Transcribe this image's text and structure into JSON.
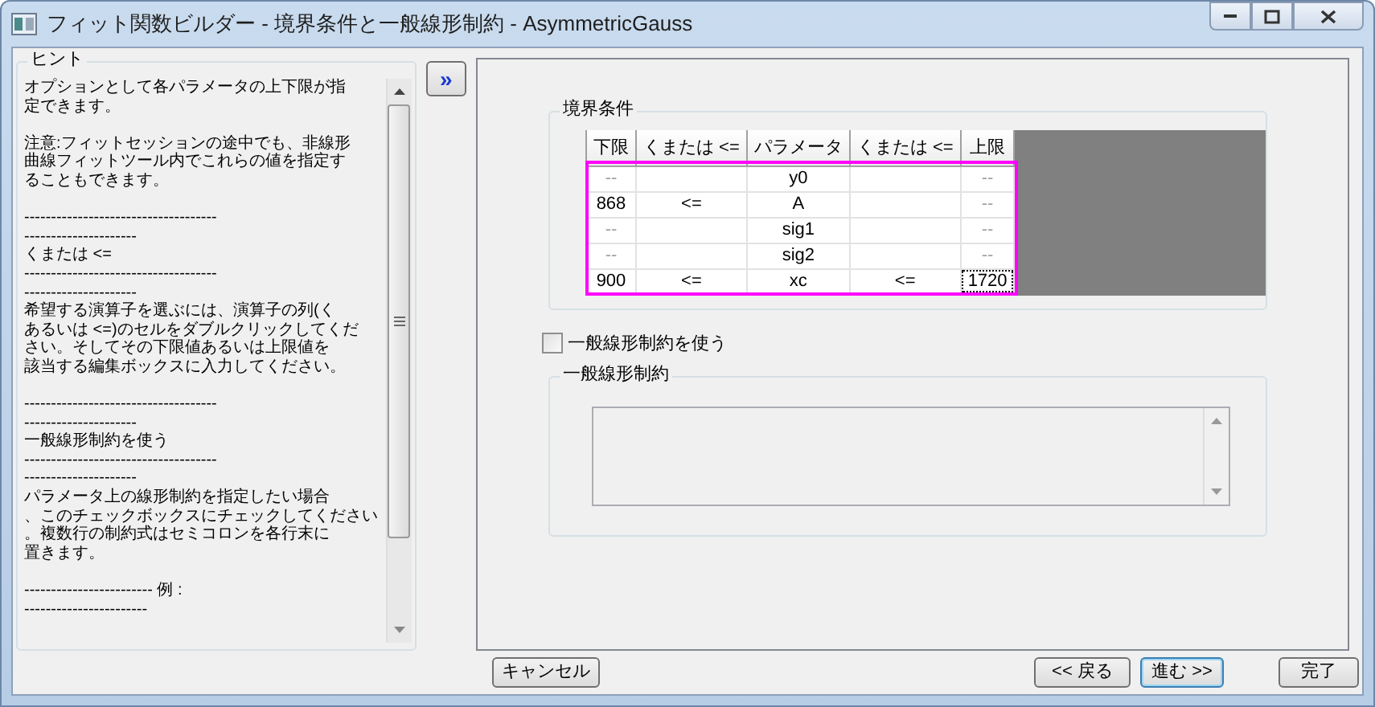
{
  "window": {
    "title": "フィット関数ビルダー - 境界条件と一般線形制約 - AsymmetricGauss"
  },
  "hint": {
    "title": "ヒント",
    "paragraphs": [
      {
        "lines": [
          "オプションとして各パラメータの上下限が指",
          "定できます。"
        ]
      },
      {
        "lines": [
          "注意:フィットセッションの途中でも、非線形",
          "曲線フィットツール内でこれらの値を指定す",
          "ることもできます。"
        ]
      },
      {
        "lines": [
          "------------------------------------",
          "---------------------",
          "くまたは <=",
          "------------------------------------",
          "---------------------",
          "希望する演算子を選ぶには、演算子の列(く",
          "あるいは <=)のセルをダブルクリックしてくだ",
          "さい。そしてその下限値あるいは上限値を",
          "該当する編集ボックスに入力してください。"
        ]
      },
      {
        "lines": [
          "------------------------------------",
          "---------------------",
          "一般線形制約を使う",
          "------------------------------------",
          "---------------------",
          "パラメータ上の線形制約を指定したい場合",
          "、このチェックボックスにチェックしてください",
          "。複数行の制約式はセミコロンを各行末に",
          "置きます。"
        ]
      },
      {
        "lines": [
          "------------------------ 例 :",
          "-----------------------"
        ]
      }
    ]
  },
  "expand_button": "»",
  "bounds": {
    "title": "境界条件",
    "columns": [
      "下限",
      "くまたは <=",
      "パラメータ",
      "くまたは <=",
      "上限"
    ],
    "rows": [
      {
        "lower": {
          "text": "--",
          "dim": true
        },
        "parameter": "y0",
        "upper": {
          "text": "--",
          "dim": true,
          "focused": false
        }
      },
      {
        "lower": {
          "text": "868",
          "dim": false
        },
        "lower_op": "<=",
        "parameter": "A",
        "upper": {
          "text": "--",
          "dim": true,
          "focused": false
        }
      },
      {
        "lower": {
          "text": "--",
          "dim": true
        },
        "parameter": "sig1",
        "upper": {
          "text": "--",
          "dim": true,
          "focused": false
        }
      },
      {
        "lower": {
          "text": "--",
          "dim": true
        },
        "parameter": "sig2",
        "upper": {
          "text": "--",
          "dim": true,
          "focused": false
        }
      },
      {
        "lower": {
          "text": "900",
          "dim": false
        },
        "lower_op": "<=",
        "parameter": "xc",
        "upper_op": "<=",
        "upper": {
          "text": "1720",
          "dim": false,
          "focused": true
        }
      }
    ]
  },
  "linear": {
    "checkbox": {
      "label": "一般線形制約を使う",
      "checked": false
    },
    "title": "一般線形制約",
    "disabled": true
  },
  "buttons": [
    {
      "label": "キャンセル",
      "focused": false
    },
    {
      "label": "<< 戻る",
      "focused": false
    },
    {
      "label": "進む >>",
      "focused": true
    },
    {
      "label": "完了",
      "focused": false
    }
  ]
}
